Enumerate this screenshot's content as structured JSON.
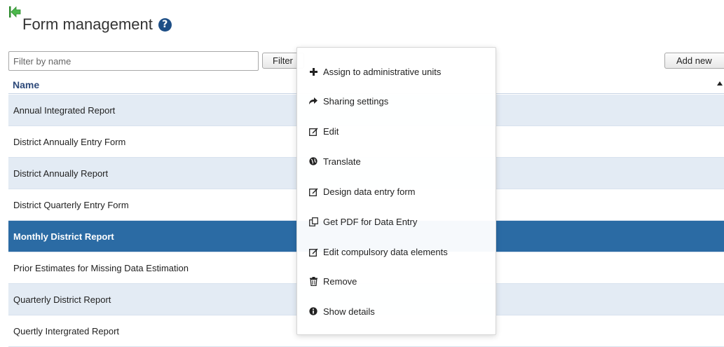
{
  "header": {
    "title": "Form management",
    "back_icon": "back-arrow-icon",
    "help_icon": "help-icon",
    "help_glyph": "?"
  },
  "toolbar": {
    "filter_placeholder": "Filter by name",
    "filter_value": "",
    "filter_label": "Filter",
    "add_new_label": "Add new"
  },
  "table": {
    "column_header": "Name",
    "sort": "ascending",
    "rows": [
      "Annual Integrated Report",
      "District Annually Entry Form",
      "District Annually Report",
      "District Quarterly Entry Form",
      "Monthly District Report",
      "Prior Estimates for Missing Data Estimation",
      "Quarterly District Report",
      "Quertly Intergrated Report"
    ],
    "selected_row": "Monthly District Report"
  },
  "context_menu": {
    "items": [
      {
        "label": "Assign to administrative units",
        "icon": "plus-icon"
      },
      {
        "label": "Sharing settings",
        "icon": "share-icon"
      },
      {
        "label": "Edit",
        "icon": "edit-icon"
      },
      {
        "label": "Translate",
        "icon": "globe-icon"
      },
      {
        "label": "Design data entry form",
        "icon": "edit-icon"
      },
      {
        "label": "Get PDF for Data Entry",
        "icon": "copy-icon"
      },
      {
        "label": "Edit compulsory data elements",
        "icon": "edit-icon"
      },
      {
        "label": "Remove",
        "icon": "trash-icon"
      },
      {
        "label": "Show details",
        "icon": "info-icon"
      }
    ]
  },
  "colors": {
    "selected_row": "#2b6ba4",
    "alt_row": "#e3ebf4",
    "header_text": "#2e4a7a",
    "back_icon": "#3aa63a"
  }
}
